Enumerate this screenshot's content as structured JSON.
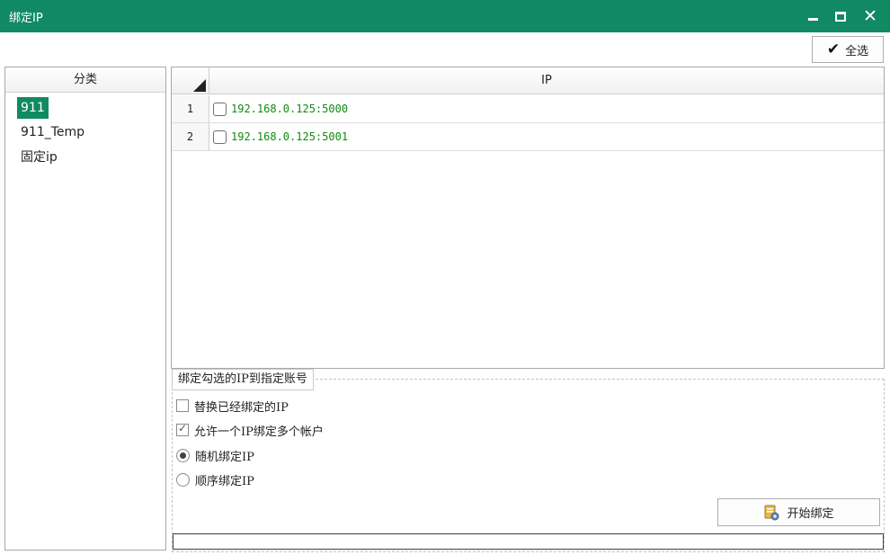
{
  "window": {
    "title": "绑定IP",
    "controls": {
      "minimize_icon": "minimize-icon",
      "maximize_icon": "maximize-icon",
      "close_icon": "close-icon"
    },
    "accent_color": "#118a63"
  },
  "toolbar": {
    "select_all_label": "全选",
    "select_all_icon": "checkmark-icon"
  },
  "category_panel": {
    "header": "分类",
    "items": [
      {
        "label": "911",
        "selected": true
      },
      {
        "label": "911_Temp",
        "selected": false
      },
      {
        "label": "固定ip",
        "selected": false
      }
    ]
  },
  "grid": {
    "column_header": "IP",
    "rows": [
      {
        "num": "1",
        "ip": "192.168.0.125:5000",
        "checked": false
      },
      {
        "num": "2",
        "ip": "192.168.0.125:5001",
        "checked": false
      }
    ],
    "ip_text_color": "#118a10"
  },
  "bind_options": {
    "group_title": "绑定勾选的IP到指定账号",
    "replace_existing": {
      "label": "替换已经绑定的IP",
      "checked": false
    },
    "allow_multiple": {
      "label": "允许一个IP绑定多个帐户",
      "checked": true
    },
    "mode_random": {
      "label": "随机绑定IP",
      "selected": true
    },
    "mode_sequential": {
      "label": "顺序绑定IP",
      "selected": false
    }
  },
  "start_button": {
    "label": "开始绑定",
    "icon": "bind-start-icon"
  },
  "progress": {
    "value": 0
  }
}
